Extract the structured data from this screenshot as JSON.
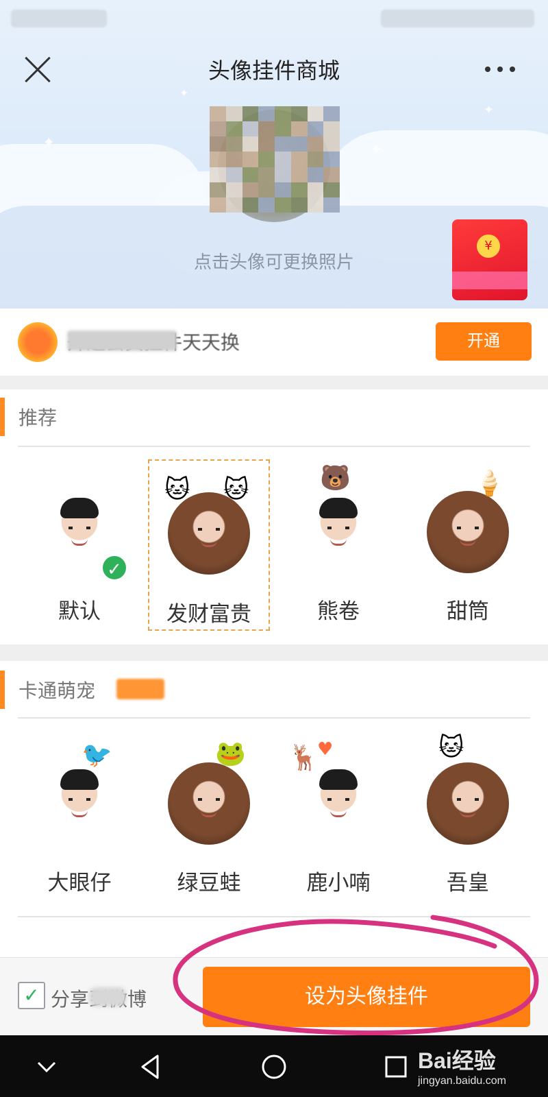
{
  "header": {
    "title": "头像挂件商城",
    "avatar_hint": "点击头像可更换照片"
  },
  "vip_banner": {
    "text": "开通会员挂件天天换",
    "button_label": "开通"
  },
  "sections": [
    {
      "title": "推荐",
      "items": [
        {
          "label": "默认",
          "gender": "male",
          "pendant": "none",
          "applied": true,
          "selected": false
        },
        {
          "label": "发财富贵",
          "gender": "female",
          "pendant": "cat-ears",
          "applied": false,
          "selected": true
        },
        {
          "label": "熊卷",
          "gender": "male",
          "pendant": "bear",
          "applied": false,
          "selected": false
        },
        {
          "label": "甜筒",
          "gender": "female",
          "pendant": "ice-cream",
          "applied": false,
          "selected": false
        }
      ]
    },
    {
      "title": "卡通萌宠",
      "items": [
        {
          "label": "大眼仔",
          "gender": "male",
          "pendant": "red-bird",
          "applied": false,
          "selected": false
        },
        {
          "label": "绿豆蛙",
          "gender": "female",
          "pendant": "green-frog",
          "applied": false,
          "selected": false
        },
        {
          "label": "鹿小喃",
          "gender": "male",
          "pendant": "yellow-deer",
          "applied": false,
          "selected": false
        },
        {
          "label": "吾皇",
          "gender": "female",
          "pendant": "black-cat",
          "applied": false,
          "selected": false
        }
      ]
    }
  ],
  "bottom_bar": {
    "share_label": "分享到微博",
    "share_checked": true,
    "set_button_label": "设为头像挂件"
  },
  "watermark": {
    "brand": "Bai经验",
    "url": "jingyan.baidu.com"
  },
  "colors": {
    "accent": "#ff7f12",
    "check_green": "#2fb15a",
    "selected_border": "#e8a44a",
    "annotation": "#d6327f"
  }
}
